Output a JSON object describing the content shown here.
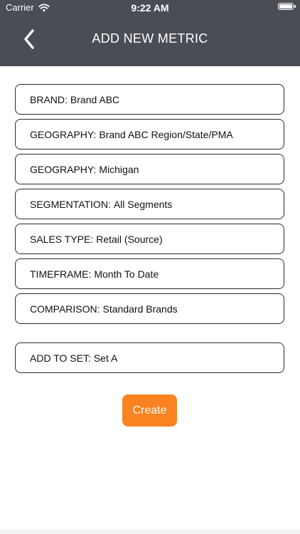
{
  "status_bar": {
    "carrier": "Carrier",
    "time": "9:22 AM",
    "wifi_icon": "wifi-icon",
    "battery_icon": "battery-icon"
  },
  "header": {
    "title": "ADD NEW METRIC",
    "back_icon": "chevron-left-icon",
    "background_color": "#4b4d55"
  },
  "fields": [
    {
      "label": "BRAND:",
      "value": "Brand ABC"
    },
    {
      "label": "GEOGRAPHY:",
      "value": "Brand ABC Region/State/PMA"
    },
    {
      "label": "GEOGRAPHY:",
      "value": "Michigan"
    },
    {
      "label": "SEGMENTATION:",
      "value": "All Segments"
    },
    {
      "label": "SALES TYPE:",
      "value": "Retail (Source)"
    },
    {
      "label": "TIMEFRAME:",
      "value": "Month To Date"
    },
    {
      "label": "COMPARISON:",
      "value": "Standard Brands"
    }
  ],
  "set_field": {
    "label": "ADD TO SET:",
    "value": "Set A"
  },
  "create_button": {
    "label": "Create",
    "color": "#fb8220"
  }
}
